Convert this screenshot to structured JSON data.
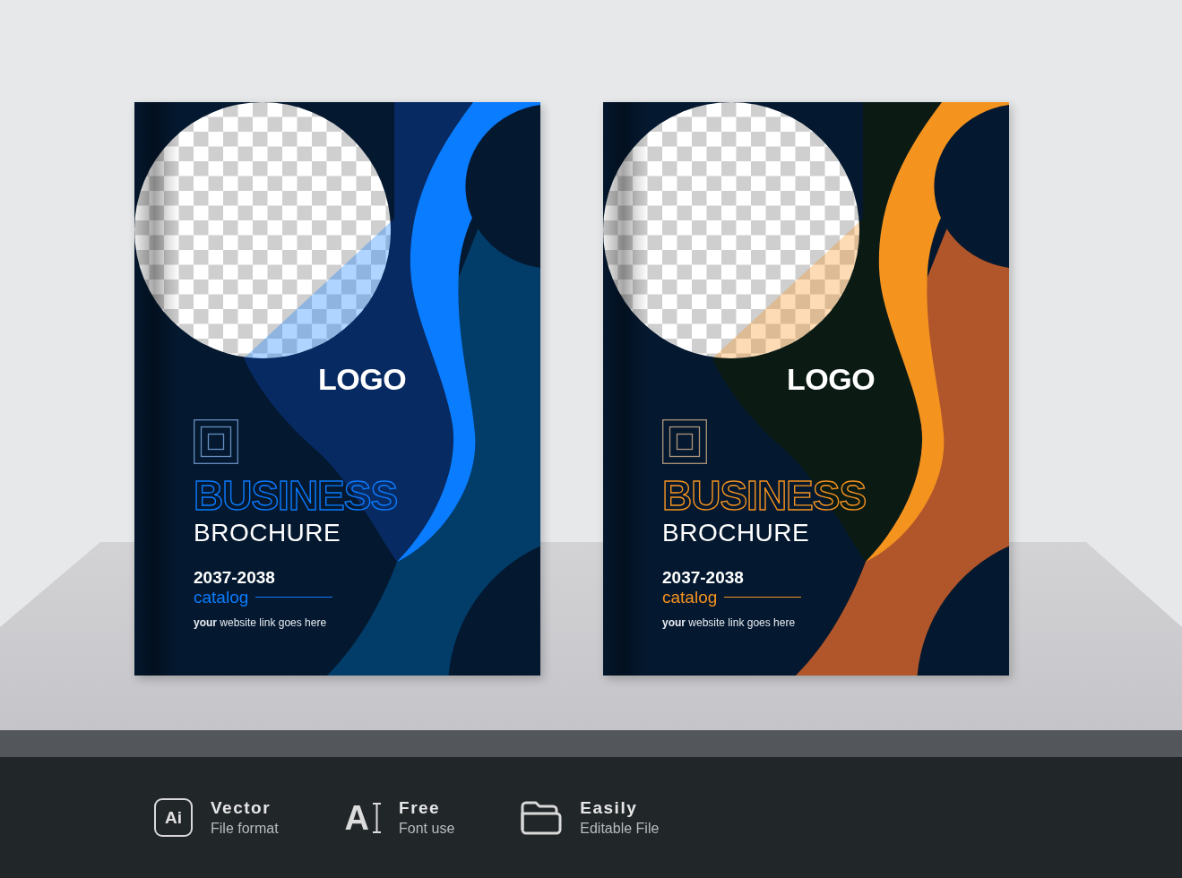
{
  "brochures": [
    {
      "logo": "LOGO",
      "title": "BUSINESS",
      "subtitle": "BROCHURE",
      "year": "2037-2038",
      "label": "catalog",
      "website": "**your** website link goes here",
      "color": "#0a7cff",
      "shapes": [
        {
          "kind": "blob",
          "color": "#082a62"
        },
        {
          "kind": "wave",
          "color": "#023c68"
        }
      ]
    },
    {
      "logo": "LOGO",
      "title": "BUSINESS",
      "subtitle": "BROCHURE",
      "year": "2037-2038",
      "label": "catalog",
      "website": "**your** website link goes here",
      "color": "#f5931f",
      "shapes": [
        {
          "kind": "blob",
          "color": "#0b1b14"
        },
        {
          "kind": "wave",
          "color": "#b0562a"
        }
      ]
    }
  ],
  "features": [
    {
      "kind": "badge",
      "icon_text": "Ai",
      "title": "Vector",
      "subtitle": "File format"
    },
    {
      "kind": "font",
      "icon_text": "A",
      "title": "Free",
      "subtitle": "Font use"
    },
    {
      "kind": "folder",
      "title": "Easily",
      "subtitle": "Editable File"
    }
  ]
}
